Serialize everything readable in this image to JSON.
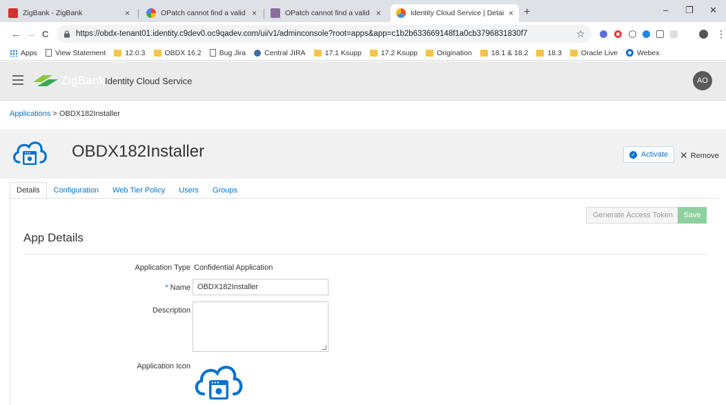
{
  "browser": {
    "tabs": [
      {
        "title": "ZigBank - ZigBank",
        "close": "×"
      },
      {
        "title": "OPatch cannot find a valid oraIn",
        "close": "×"
      },
      {
        "title": "OPatch cannot find a valid oraIn",
        "close": "×"
      },
      {
        "title": "Identity Cloud Service | Details",
        "close": "×"
      }
    ],
    "new_tab": "+",
    "window_controls": {
      "minimize": "–",
      "maximize": "❐",
      "close": "✕"
    },
    "nav": {
      "back": "←",
      "forward": "→",
      "reload": "C"
    },
    "url": "https://obdx-tenant01.identity.c9dev0.oc9qadev.com/ui/v1/adminconsole?root=apps&app=c1b2b633669148f1a0cb3796831830f7",
    "star": "☆",
    "menu": "⋮"
  },
  "bookmarks": [
    {
      "label": "Apps",
      "icon": "grid"
    },
    {
      "label": "View Statement",
      "icon": "page"
    },
    {
      "label": "12.0.3",
      "icon": "folder"
    },
    {
      "label": "OBDX 16.2",
      "icon": "folder"
    },
    {
      "label": "Bug Jira",
      "icon": "page"
    },
    {
      "label": "Central JIRA",
      "icon": "jira"
    },
    {
      "label": "17.1 Ksupp",
      "icon": "folder"
    },
    {
      "label": "17.2 Ksupp",
      "icon": "folder"
    },
    {
      "label": "Origination",
      "icon": "folder"
    },
    {
      "label": "18.1 & 18.2",
      "icon": "folder"
    },
    {
      "label": "18.3",
      "icon": "folder"
    },
    {
      "label": "Oracle Live",
      "icon": "folder"
    },
    {
      "label": "Webex",
      "icon": "webex"
    }
  ],
  "header": {
    "brand": "ZigBank",
    "service_name": "Identity Cloud Service",
    "avatar_initials": "AO"
  },
  "breadcrumb": {
    "parent": "Applications",
    "separator": ">",
    "current": "OBDX182Installer"
  },
  "app": {
    "title": "OBDX182Installer",
    "activate_label": "Activate",
    "remove_label": "Remove"
  },
  "tabs": [
    "Details",
    "Configuration",
    "Web Tier Policy",
    "Users",
    "Groups"
  ],
  "actions": {
    "generate_token": "Generate Access Token",
    "save": "Save"
  },
  "details": {
    "section_title": "App Details",
    "app_type_label": "Application Type",
    "app_type_value": "Confidential Application",
    "name_required": "*",
    "name_label": "Name",
    "name_value": "OBDX182Installer",
    "description_label": "Description",
    "description_value": "",
    "icon_label": "Application Icon"
  },
  "colors": {
    "accent": "#0572ce",
    "save_disabled": "#8fd19e",
    "header_bg": "#ebebeb"
  }
}
